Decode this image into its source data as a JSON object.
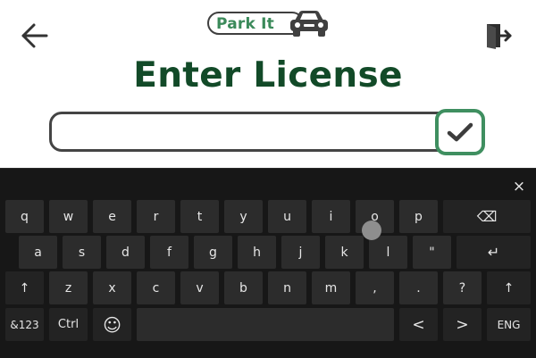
{
  "app": {
    "logo_text": "Park It",
    "title": "Enter License"
  },
  "header": {
    "back_icon": "arrow-left-icon",
    "exit_icon": "exit-door-icon",
    "logo_icon": "car-icon"
  },
  "license_input": {
    "value": "",
    "placeholder": ""
  },
  "submit": {
    "icon": "checkmark-icon"
  },
  "colors": {
    "title": "#124a28",
    "accent_green": "#3f8f60",
    "keyboard_bg": "#171717",
    "key_bg": "#2c2c2c"
  },
  "keyboard": {
    "close_label": "×",
    "rows": [
      [
        "q",
        "w",
        "e",
        "r",
        "t",
        "y",
        "u",
        "i",
        "o",
        "p",
        "⌫"
      ],
      [
        "a",
        "s",
        "d",
        "f",
        "g",
        "h",
        "j",
        "k",
        "l",
        "\"",
        "↵"
      ],
      [
        "↑",
        "z",
        "x",
        "c",
        "v",
        "b",
        "n",
        "m",
        ",",
        ".",
        "?",
        "↑"
      ],
      [
        "&123",
        "Ctrl",
        "☺",
        "",
        "<",
        ">",
        "ENG"
      ]
    ]
  }
}
